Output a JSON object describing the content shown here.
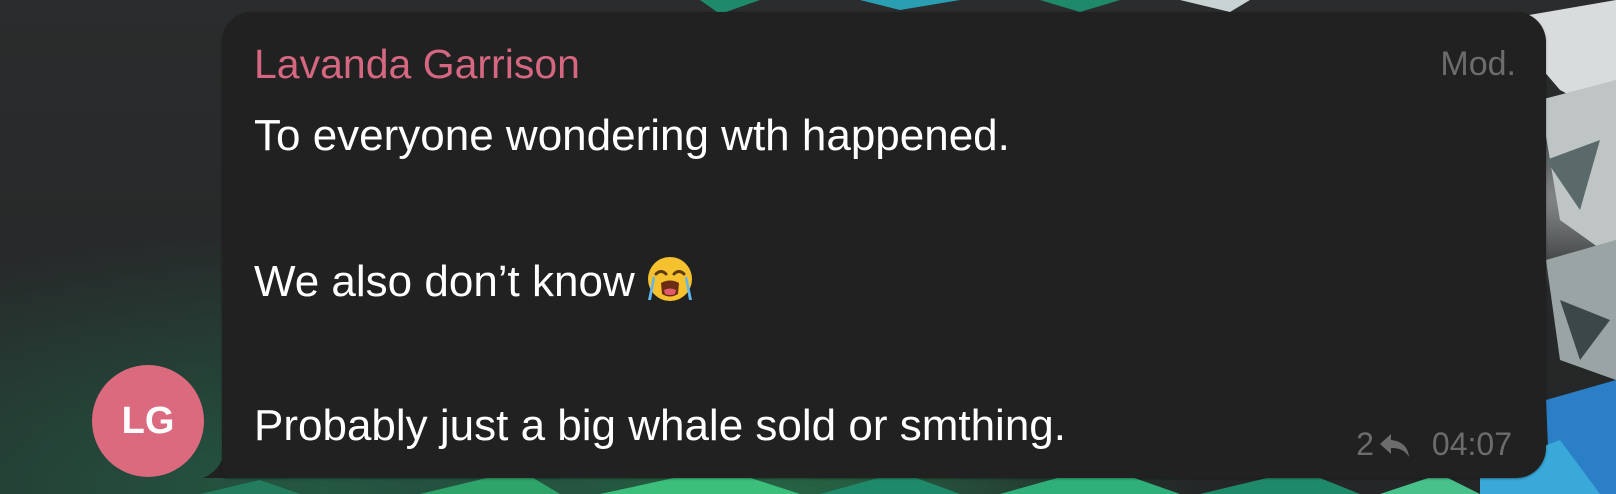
{
  "message": {
    "sender_name": "Lavanda Garrison",
    "role_badge": "Mod.",
    "lines": [
      "To everyone wondering wth happened.",
      "We also don’t know",
      "Probably just a big whale sold or smthing."
    ],
    "emoji": "loudly-crying-face",
    "reply_count": "2",
    "time": "04:07"
  },
  "avatar": {
    "initials": "LG",
    "color": "#dc6a7e"
  },
  "colors": {
    "sender_name": "#d56780",
    "bubble": "#212121",
    "meta_text": "#6c6c6c",
    "message_text": "#ffffff"
  }
}
